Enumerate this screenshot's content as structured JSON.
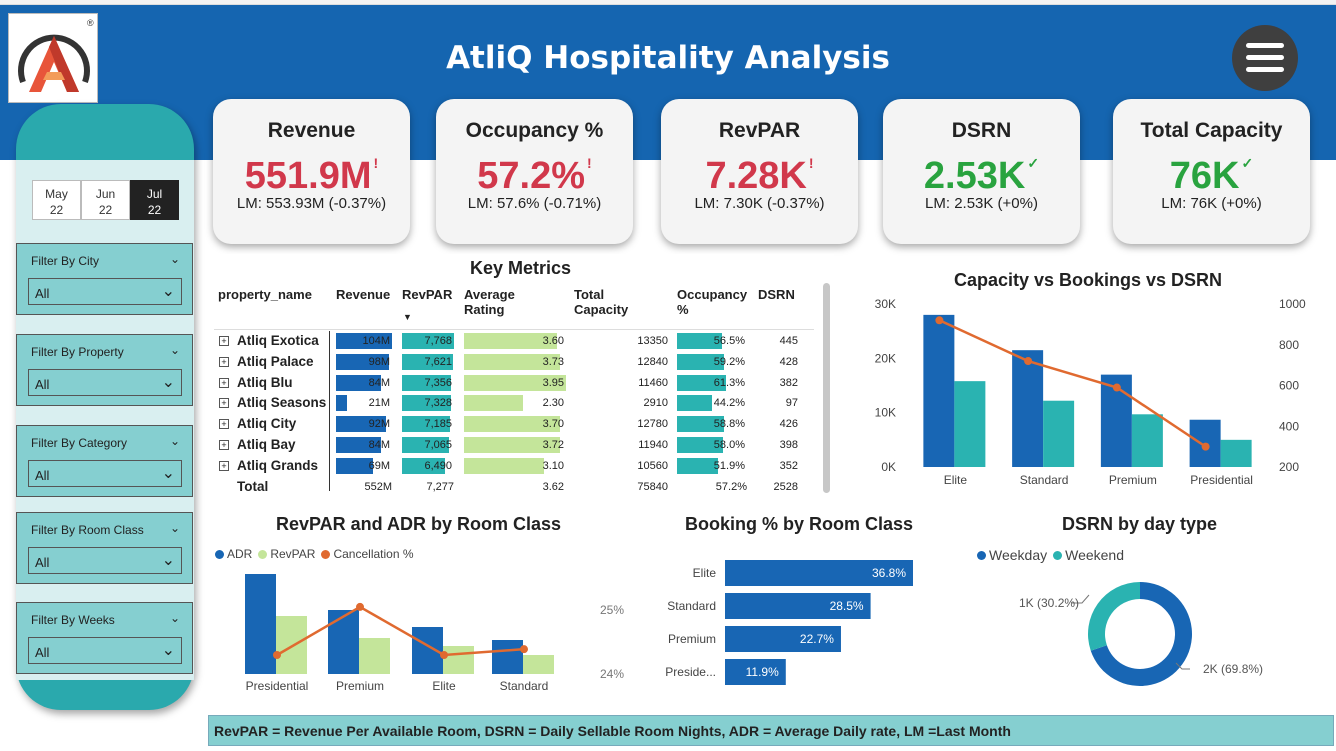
{
  "header": {
    "title": "AtliQ Hospitality Analysis"
  },
  "dates": [
    {
      "month": "May",
      "year": "22",
      "active": false
    },
    {
      "month": "Jun",
      "year": "22",
      "active": false
    },
    {
      "month": "Jul",
      "year": "22",
      "active": true
    }
  ],
  "filters": [
    {
      "label": "Filter By City",
      "value": "All"
    },
    {
      "label": "Filter By Property",
      "value": "All"
    },
    {
      "label": "Filter By Category",
      "value": "All"
    },
    {
      "label": "Filter By Room Class",
      "value": "All"
    },
    {
      "label": "Filter By Weeks",
      "value": "All"
    }
  ],
  "kpis": [
    {
      "label": "Revenue",
      "value": "551.9M",
      "mark": "!",
      "lm": "LM: 553.93M (-0.37%)",
      "status": "bad"
    },
    {
      "label": "Occupancy %",
      "value": "57.2%",
      "mark": "!",
      "lm": "LM: 57.6% (-0.71%)",
      "status": "bad"
    },
    {
      "label": "RevPAR",
      "value": "7.28K",
      "mark": "!",
      "lm": "LM: 7.30K (-0.37%)",
      "status": "bad"
    },
    {
      "label": "DSRN",
      "value": "2.53K",
      "mark": "✓",
      "lm": "LM: 2.53K (+0%)",
      "status": "good"
    },
    {
      "label": "Total Capacity",
      "value": "76K",
      "mark": "✓",
      "lm": "LM: 76K (+0%)",
      "status": "good"
    }
  ],
  "key_metrics": {
    "title": "Key Metrics",
    "columns": [
      "property_name",
      "Revenue",
      "RevPAR",
      "Average Rating",
      "Total Capacity",
      "Occupancy %",
      "DSRN"
    ],
    "rows": [
      {
        "name": "Atliq Exotica",
        "revenue": "104M",
        "revenue_val": 104,
        "revpar": "7,768",
        "revpar_val": 7768,
        "rating": "3.60",
        "rating_val": 3.6,
        "capacity": "13350",
        "occupancy": "56.5%",
        "occ_val": 56.5,
        "dsrn": "445"
      },
      {
        "name": "Atliq Palace",
        "revenue": "98M",
        "revenue_val": 98,
        "revpar": "7,621",
        "revpar_val": 7621,
        "rating": "3.73",
        "rating_val": 3.73,
        "capacity": "12840",
        "occupancy": "59.2%",
        "occ_val": 59.2,
        "dsrn": "428"
      },
      {
        "name": "Atliq Blu",
        "revenue": "84M",
        "revenue_val": 84,
        "revpar": "7,356",
        "revpar_val": 7356,
        "rating": "3.95",
        "rating_val": 3.95,
        "capacity": "11460",
        "occupancy": "61.3%",
        "occ_val": 61.3,
        "dsrn": "382"
      },
      {
        "name": "Atliq Seasons",
        "revenue": "21M",
        "revenue_val": 21,
        "revpar": "7,328",
        "revpar_val": 7328,
        "rating": "2.30",
        "rating_val": 2.3,
        "capacity": "2910",
        "occupancy": "44.2%",
        "occ_val": 44.2,
        "dsrn": "97"
      },
      {
        "name": "Atliq City",
        "revenue": "92M",
        "revenue_val": 92,
        "revpar": "7,185",
        "revpar_val": 7185,
        "rating": "3.70",
        "rating_val": 3.7,
        "capacity": "12780",
        "occupancy": "58.8%",
        "occ_val": 58.8,
        "dsrn": "426"
      },
      {
        "name": "Atliq Bay",
        "revenue": "84M",
        "revenue_val": 84,
        "revpar": "7,065",
        "revpar_val": 7065,
        "rating": "3.72",
        "rating_val": 3.72,
        "capacity": "11940",
        "occupancy": "58.0%",
        "occ_val": 58.0,
        "dsrn": "398"
      },
      {
        "name": "Atliq Grands",
        "revenue": "69M",
        "revenue_val": 69,
        "revpar": "6,490",
        "revpar_val": 6490,
        "rating": "3.10",
        "rating_val": 3.1,
        "capacity": "10560",
        "occupancy": "51.9%",
        "occ_val": 51.9,
        "dsrn": "352"
      }
    ],
    "total": {
      "name": "Total",
      "revenue": "552M",
      "revpar": "7,277",
      "rating": "3.62",
      "capacity": "75840",
      "occupancy": "57.2%",
      "dsrn": "2528"
    }
  },
  "footer": {
    "text": "RevPAR = Revenue Per Available Room, DSRN = Daily Sellable Room Nights, ADR = Average Daily rate, LM =Last Month"
  },
  "colors": {
    "dark_blue": "#1866b4",
    "teal": "#2ab3b1",
    "orange": "#e06a30",
    "light_green": "#c4e59a",
    "red": "#d1384b",
    "green": "#29a33f"
  },
  "chart_data": [
    {
      "type": "bar",
      "title": "Capacity vs Bookings vs DSRN",
      "categories": [
        "Elite",
        "Standard",
        "Premium",
        "Presidential"
      ],
      "series": [
        {
          "values": [
            28000,
            21500,
            17000,
            8700
          ]
        },
        {
          "values": [
            15800,
            12200,
            9700,
            5000
          ]
        },
        {
          "values": [
            920,
            720,
            590,
            300
          ]
        }
      ],
      "ylim": [
        0,
        30000
      ],
      "y2lim": [
        200,
        1000
      ],
      "yticks": [
        "0K",
        "10K",
        "20K",
        "30K"
      ],
      "y2ticks": [
        "200",
        "400",
        "600",
        "800",
        "1000"
      ]
    },
    {
      "type": "bar",
      "title": "RevPAR and ADR by Room Class",
      "categories": [
        "Presidential",
        "Premium",
        "Elite",
        "Standard"
      ],
      "series": [
        {
          "name": "ADR",
          "values": [
            100,
            64,
            47,
            34
          ]
        },
        {
          "name": "RevPAR",
          "values": [
            58,
            36,
            28,
            19
          ]
        },
        {
          "name": "Cancellation %",
          "values": [
            24.28,
            25.02,
            24.28,
            24.37
          ]
        }
      ],
      "y2ticks": [
        "25%",
        "24%"
      ]
    },
    {
      "type": "bar",
      "title": "Booking % by Room Class",
      "categories": [
        "Elite",
        "Standard",
        "Premium",
        "Preside..."
      ],
      "values": [
        36.8,
        28.5,
        22.7,
        11.9
      ],
      "labels": [
        "36.8%",
        "28.5%",
        "22.7%",
        "11.9%"
      ]
    },
    {
      "type": "pie",
      "title": "DSRN by day type",
      "categories": [
        "Weekday",
        "Weekend"
      ],
      "values": [
        69.8,
        30.2
      ],
      "labels": [
        "2K (69.8%)",
        "1K (30.2%)"
      ]
    }
  ]
}
